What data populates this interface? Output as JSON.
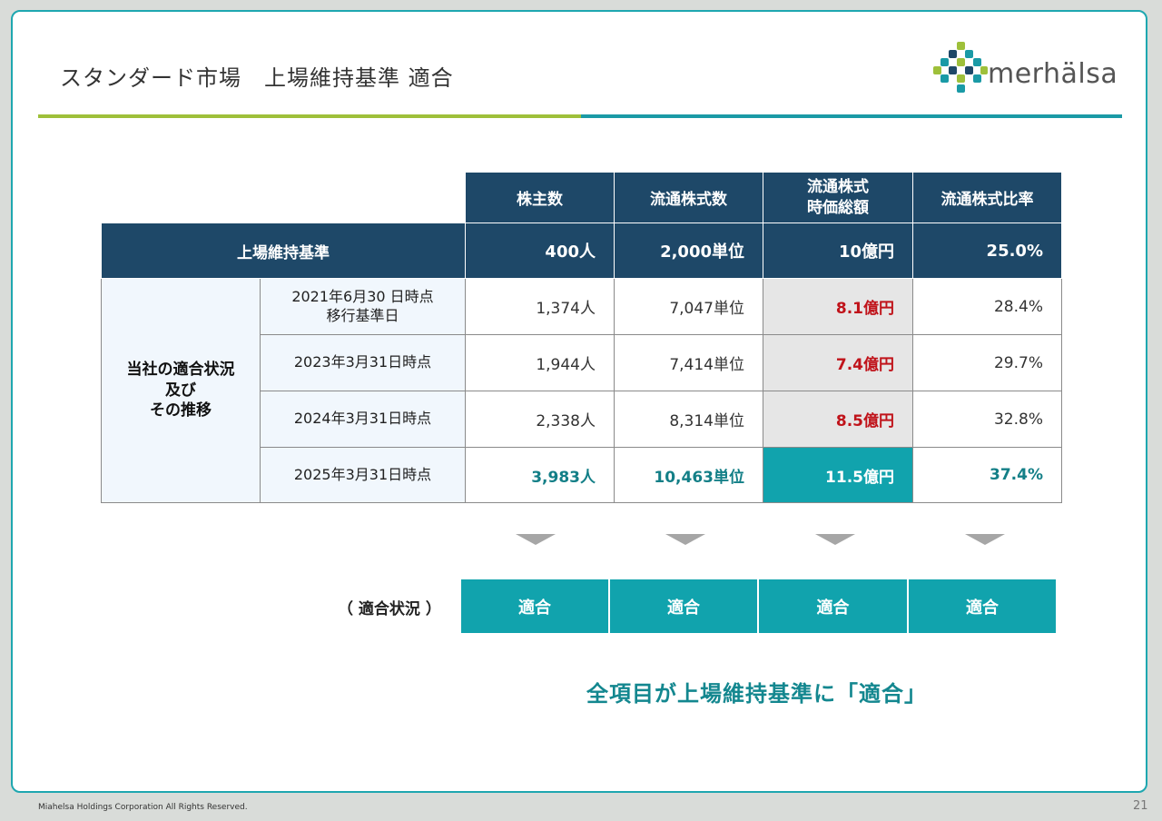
{
  "header": {
    "title": "スタンダード市場　上場維持基準  適合",
    "logo_text": "merhälsa"
  },
  "table": {
    "columns": [
      "株主数",
      "流通株式数",
      "流通株式\n時価総額",
      "流通株式比率"
    ],
    "standard": {
      "label": "上場維持基準",
      "values": [
        "400人",
        "2,000単位",
        "10億円",
        "25.0%"
      ]
    },
    "group_label": "当社の適合状況\n及び\nその推移",
    "rows": [
      {
        "date": "2021年6月30 日時点\n移行基準日",
        "values": [
          "1,374人",
          "7,047単位",
          "8.1億円",
          "28.4%"
        ]
      },
      {
        "date": "2023年3月31日時点",
        "values": [
          "1,944人",
          "7,414単位",
          "7.4億円",
          "29.7%"
        ]
      },
      {
        "date": "2024年3月31日時点",
        "values": [
          "2,338人",
          "8,314単位",
          "8.5億円",
          "32.8%"
        ]
      },
      {
        "date": "2025年3月31日時点",
        "values": [
          "3,983人",
          "10,463単位",
          "11.5億円",
          "37.4%"
        ]
      }
    ]
  },
  "status": {
    "label": "（ 適合状況 ）",
    "items": [
      "適合",
      "適合",
      "適合",
      "適合"
    ]
  },
  "conclusion": "全項目が上場維持基準に「適合」",
  "footer": {
    "copyright": "Miahelsa Holdings Corporation All Rights Reserved.",
    "page": "21"
  },
  "colors": {
    "header_navy": "#1e4868",
    "accent_teal": "#11a3ad",
    "warn_red": "#c0131a",
    "rule_green": "#9ec03a"
  }
}
